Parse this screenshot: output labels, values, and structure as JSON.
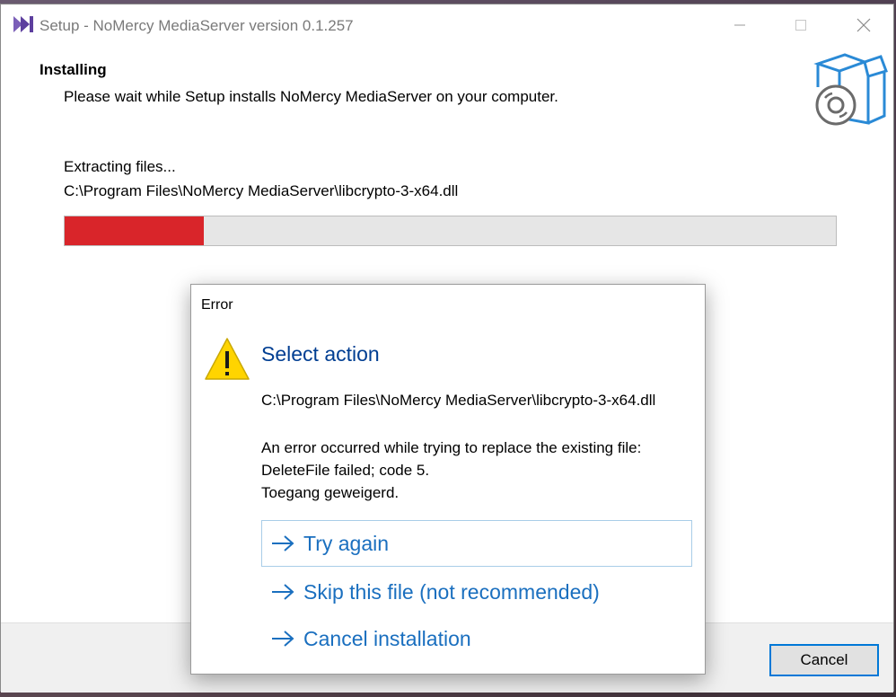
{
  "window": {
    "title": "Setup - NoMercy MediaServer version 0.1.257"
  },
  "header": {
    "title": "Installing",
    "subtitle": "Please wait while Setup installs NoMercy MediaServer on your computer."
  },
  "progress": {
    "status": "Extracting files...",
    "current_file": "C:\\Program Files\\NoMercy MediaServer\\libcrypto-3-x64.dll",
    "fraction": 0.18,
    "color": "#d9252a"
  },
  "footer": {
    "cancel_label": "Cancel"
  },
  "dialog": {
    "title": "Error",
    "heading": "Select action",
    "path": "C:\\Program Files\\NoMercy MediaServer\\libcrypto-3-x64.dll",
    "message_lines": [
      "An error occurred while trying to replace the existing file:",
      "DeleteFile failed; code 5.",
      "Toegang geweigerd."
    ],
    "actions": [
      {
        "label": "Try again"
      },
      {
        "label": "Skip this file (not recommended)"
      },
      {
        "label": "Cancel installation"
      }
    ],
    "accent_color": "#1a6fbf",
    "icon": "warning-icon"
  },
  "icons": {
    "app": "app-logo-icon",
    "header": "install-box-disc-icon"
  }
}
